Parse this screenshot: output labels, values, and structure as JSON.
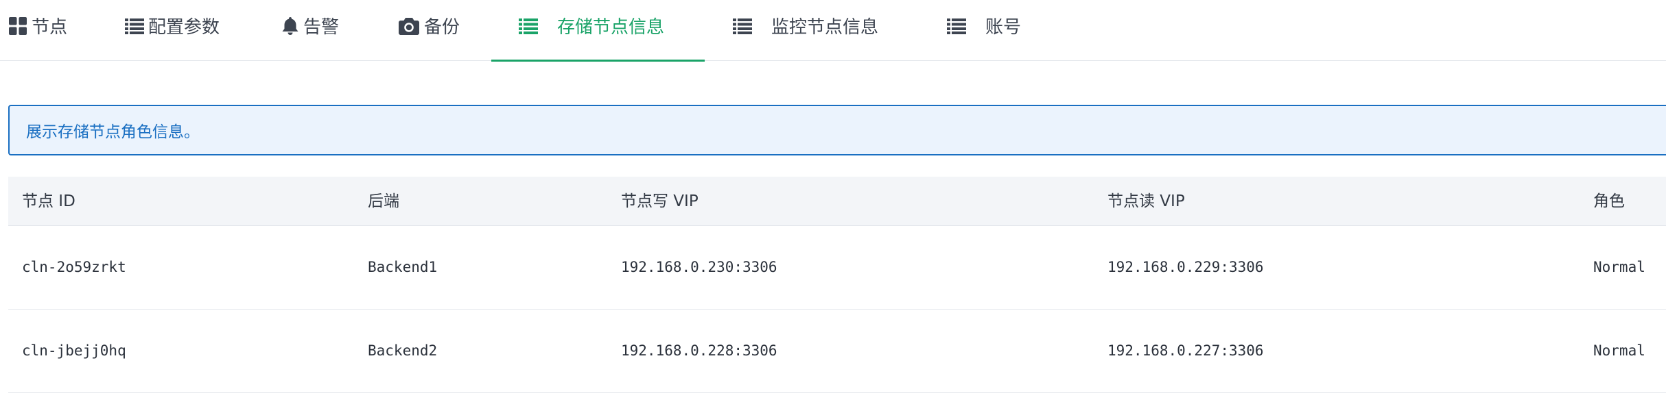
{
  "tabs": [
    {
      "label": "节点",
      "icon": "grid-icon",
      "active": false
    },
    {
      "label": "配置参数",
      "icon": "list-icon",
      "active": false
    },
    {
      "label": "告警",
      "icon": "bell-icon",
      "active": false
    },
    {
      "label": "备份",
      "icon": "camera-icon",
      "active": false
    },
    {
      "label": "存储节点信息",
      "icon": "list-icon",
      "active": true
    },
    {
      "label": "监控节点信息",
      "icon": "list-icon",
      "active": false
    },
    {
      "label": "账号",
      "icon": "list-icon",
      "active": false
    }
  ],
  "banner": {
    "text": "展示存储节点角色信息。"
  },
  "table": {
    "headers": [
      "节点 ID",
      "后端",
      "节点写 VIP",
      "节点读 VIP",
      "角色"
    ],
    "rows": [
      [
        "cln-2o59zrkt",
        "Backend1",
        "192.168.0.230:3306",
        "192.168.0.229:3306",
        "Normal"
      ],
      [
        "cln-jbejj0hq",
        "Backend2",
        "192.168.0.228:3306",
        "192.168.0.227:3306",
        "Normal"
      ]
    ]
  },
  "colors": {
    "accent": "#1aa368",
    "info_text": "#1a6fc2",
    "info_bg": "#ebf3fd",
    "header_bg": "#f3f5f8"
  }
}
